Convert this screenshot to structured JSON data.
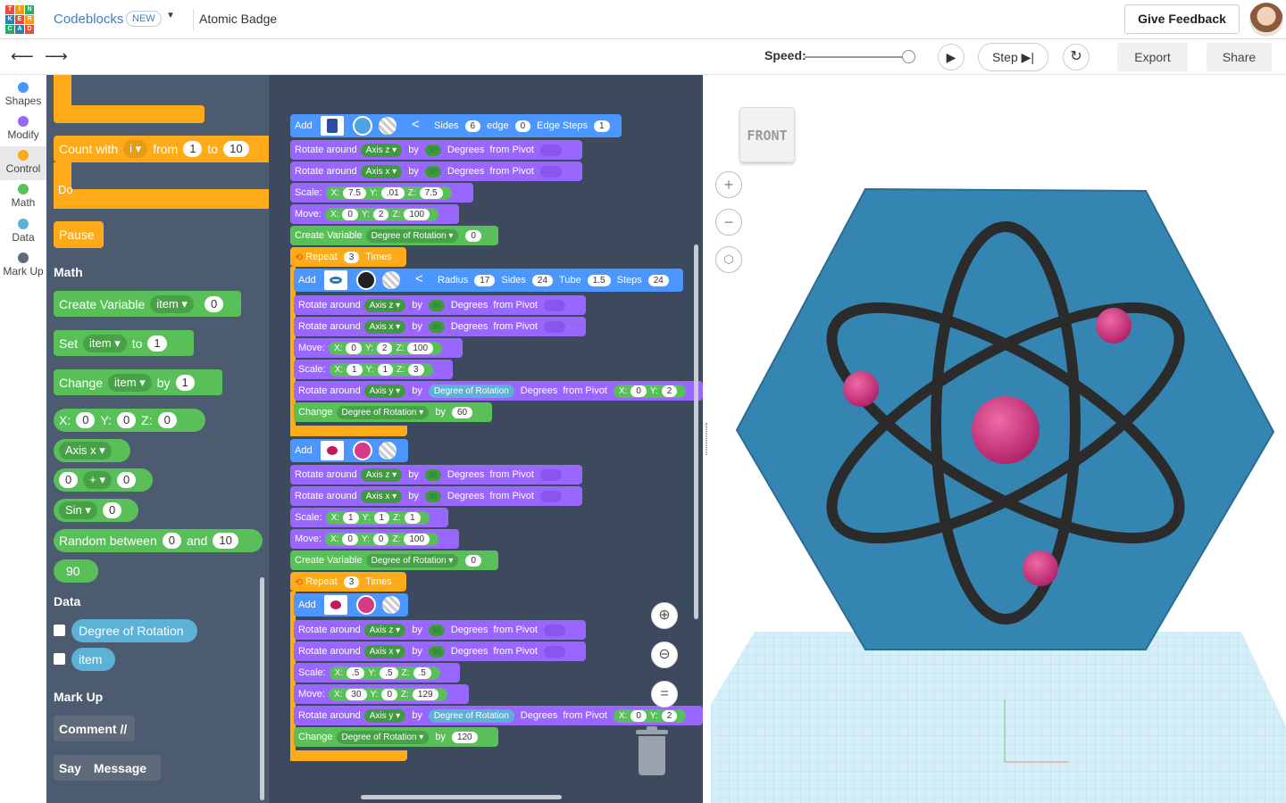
{
  "app": {
    "logo_letters": [
      "T",
      "I",
      "N",
      "K",
      "E",
      "R",
      "C",
      "A",
      "D"
    ],
    "mode": "Codeblocks",
    "mode_badge": "NEW",
    "project_title": "Atomic Badge",
    "give_feedback": "Give Feedback"
  },
  "toolbar": {
    "speed_label": "Speed:",
    "speed_value": 0.95,
    "step_label": "Step",
    "export_label": "Export",
    "share_label": "Share"
  },
  "categories": [
    {
      "label": "Shapes",
      "color": "#4c97ff"
    },
    {
      "label": "Modify",
      "color": "#9966ff"
    },
    {
      "label": "Control",
      "color": "#ffab19"
    },
    {
      "label": "Math",
      "color": "#59c059"
    },
    {
      "label": "Data",
      "color": "#5cb1d6"
    },
    {
      "label": "Mark Up",
      "color": "#5f6b7a"
    }
  ],
  "flyout": {
    "count_with": "Count with",
    "count_var": "i",
    "from_label": "from",
    "from_val": "1",
    "to_label": "to",
    "to_val": "10",
    "do_label": "Do",
    "pause": "Pause",
    "math_header": "Math",
    "create_variable": "Create Variable",
    "item": "item",
    "zero": "0",
    "set": "Set",
    "to": "to",
    "one": "1",
    "change": "Change",
    "by": "by",
    "x": "X:",
    "y": "Y:",
    "z": "Z:",
    "axis_x": "Axis x",
    "plus": "+",
    "sin": "Sin",
    "random_between": "Random between",
    "and": "and",
    "ten": "10",
    "ninety": "90",
    "data_header": "Data",
    "degree_of_rotation": "Degree of Rotation",
    "markup_header": "Mark Up",
    "comment": "Comment //",
    "say": "Say",
    "message": "Message"
  },
  "ws": {
    "add": "Add",
    "sides": "Sides",
    "sides_val": "6",
    "edge": "edge",
    "edge_val": "0",
    "edge_steps": "Edge Steps",
    "edge_steps_val": "1",
    "rotate_around": "Rotate around",
    "axis_z": "Axis z",
    "axis_x": "Axis x",
    "axis_y": "Axis y",
    "by": "by",
    "ninety": "90",
    "degrees": "Degrees",
    "from_pivot": "from Pivot",
    "scale": "Scale:",
    "move": "Move:",
    "x": "X:",
    "y": "Y:",
    "z": "Z:",
    "s1": [
      "7.5",
      ".01",
      "7.5"
    ],
    "m1": [
      "0",
      "2",
      "100"
    ],
    "create_variable": "Create Variable",
    "degree_of_rotation": "Degree of Rotation",
    "zero": "0",
    "repeat": "Repeat",
    "three": "3",
    "times": "Times",
    "radius": "Radius",
    "radius_val": "17",
    "sides2_val": "24",
    "tube": "Tube",
    "tube_val": "1.5",
    "steps": "Steps",
    "steps_val": "24",
    "m2": [
      "0",
      "2",
      "100"
    ],
    "s2": [
      "1",
      "1",
      "3"
    ],
    "change": "Change",
    "sixty": "60",
    "s3": [
      "1",
      "1",
      "1"
    ],
    "m3": [
      "0",
      "0",
      "100"
    ],
    "s4": [
      ".5",
      ".5",
      ".5"
    ],
    "m4": [
      "30",
      "0",
      "129"
    ],
    "one_twenty": "120",
    "pivot_x": "0",
    "pivot_y": "2"
  },
  "viewcube": {
    "label": "FRONT"
  },
  "colors": {
    "hexagon": "#3585b2",
    "atom": "#d63a86",
    "orbit": "#2b2b2b",
    "grid": "#bfe3f3"
  }
}
